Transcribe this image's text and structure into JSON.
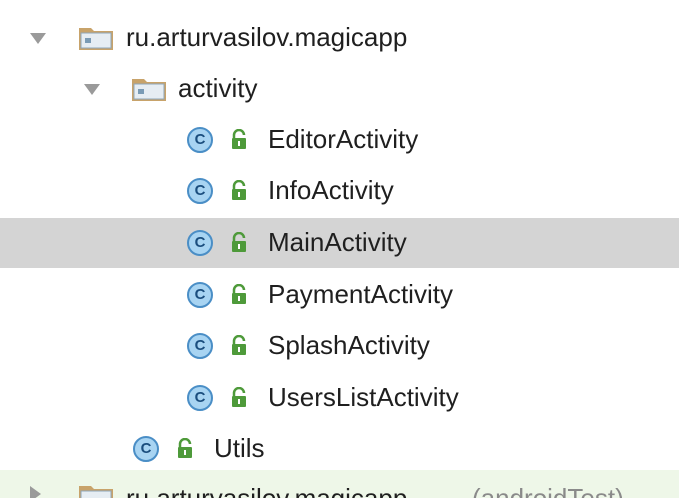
{
  "tree": {
    "root_package": "ru.arturvasilov.magicapp",
    "sub_package": "activity",
    "activity_classes": [
      "EditorActivity",
      "InfoActivity",
      "MainActivity",
      "PaymentActivity",
      "SplashActivity",
      "UsersListActivity"
    ],
    "utils_class": "Utils",
    "android_test_package": "ru.arturvasilov.magicapp",
    "android_test_suffix": "(androidTest)",
    "selected_item": "MainActivity",
    "class_icon_letter": "C"
  },
  "icons": {
    "package": "folder-package-icon",
    "class": "class-c-icon",
    "visibility": "public-lock-icon",
    "expanded": "tree-arrow-down-icon",
    "collapsed": "tree-arrow-right-icon"
  },
  "colors": {
    "selection": "#d4d4d4",
    "class_fill": "#a8d4f2",
    "class_border": "#4a8ec6",
    "lock_green": "#4e9a3a",
    "folder_tan": "#c8a36a"
  }
}
